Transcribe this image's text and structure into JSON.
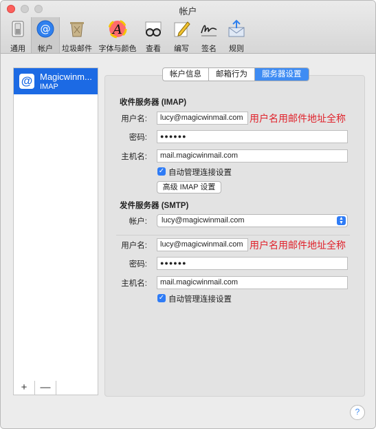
{
  "window": {
    "title": "帐户"
  },
  "toolbar": {
    "items": [
      {
        "label": "通用",
        "icon": "switch-icon"
      },
      {
        "label": "帐户",
        "icon": "at-sign-icon"
      },
      {
        "label": "垃圾邮件",
        "icon": "trash-bin-icon"
      },
      {
        "label": "字体与颜色",
        "icon": "font-icon"
      },
      {
        "label": "查看",
        "icon": "glasses-icon"
      },
      {
        "label": "编写",
        "icon": "pencil-icon"
      },
      {
        "label": "签名",
        "icon": "signature-icon"
      },
      {
        "label": "规则",
        "icon": "envelope-icon"
      }
    ],
    "selected": "帐户"
  },
  "accounts": [
    {
      "name": "Magicwinm...",
      "type": "IMAP",
      "icon": "@"
    }
  ],
  "list_footer": {
    "add": "+",
    "remove": "—"
  },
  "tabs": [
    {
      "label": "帐户信息",
      "active": false
    },
    {
      "label": "邮箱行为",
      "active": false
    },
    {
      "label": "服务器设置",
      "active": true
    }
  ],
  "incoming": {
    "title": "收件服务器 (IMAP)",
    "username_label": "用户名:",
    "username": "lucy@magicwinmail.com",
    "username_note": "用户名用邮件地址全称",
    "password_label": "密码:",
    "password": "●●●●●●",
    "host_label": "主机名:",
    "host": "mail.magicwinmail.com",
    "auto_manage": "自动管理连接设置",
    "advanced_button": "高级 IMAP 设置"
  },
  "outgoing": {
    "title": "发件服务器 (SMTP)",
    "account_label": "帐户:",
    "account": "lucy@magicwinmail.com",
    "username_label": "用户名:",
    "username": "lucy@magicwinmail.com",
    "username_note": "用户名用邮件地址全称",
    "password_label": "密码:",
    "password": "●●●●●●",
    "host_label": "主机名:",
    "host": "mail.magicwinmail.com",
    "auto_manage": "自动管理连接设置"
  },
  "help": "?",
  "colors": {
    "accent": "#1c6ae4",
    "note": "#e0222b"
  }
}
